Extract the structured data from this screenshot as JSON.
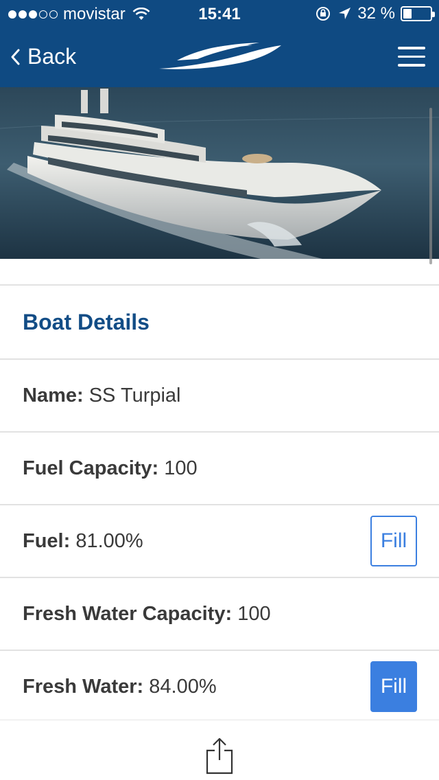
{
  "status_bar": {
    "carrier": "movistar",
    "time": "15:41",
    "battery_percent": "32 %",
    "battery_level": 0.32,
    "signal_bars_filled": 3,
    "signal_bars_total": 5
  },
  "nav": {
    "back_label": "Back"
  },
  "details": {
    "title": "Boat Details",
    "rows": [
      {
        "label": "Name:",
        "value": "SS Turpial"
      },
      {
        "label": "Fuel Capacity:",
        "value": "100"
      },
      {
        "label": "Fuel:",
        "value": "81.00%",
        "action": "Fill"
      },
      {
        "label": "Fresh Water Capacity:",
        "value": "100"
      },
      {
        "label": "Fresh Water:",
        "value": "84.00%",
        "action": "Fill"
      }
    ]
  },
  "colors": {
    "header_bg": "#0f4a82",
    "title_text": "#124d86",
    "button_blue": "#3b7fe0"
  },
  "icons": {
    "back": "chevron-left-icon",
    "menu": "hamburger-icon",
    "share": "share-icon",
    "logo": "yacht-logo"
  }
}
